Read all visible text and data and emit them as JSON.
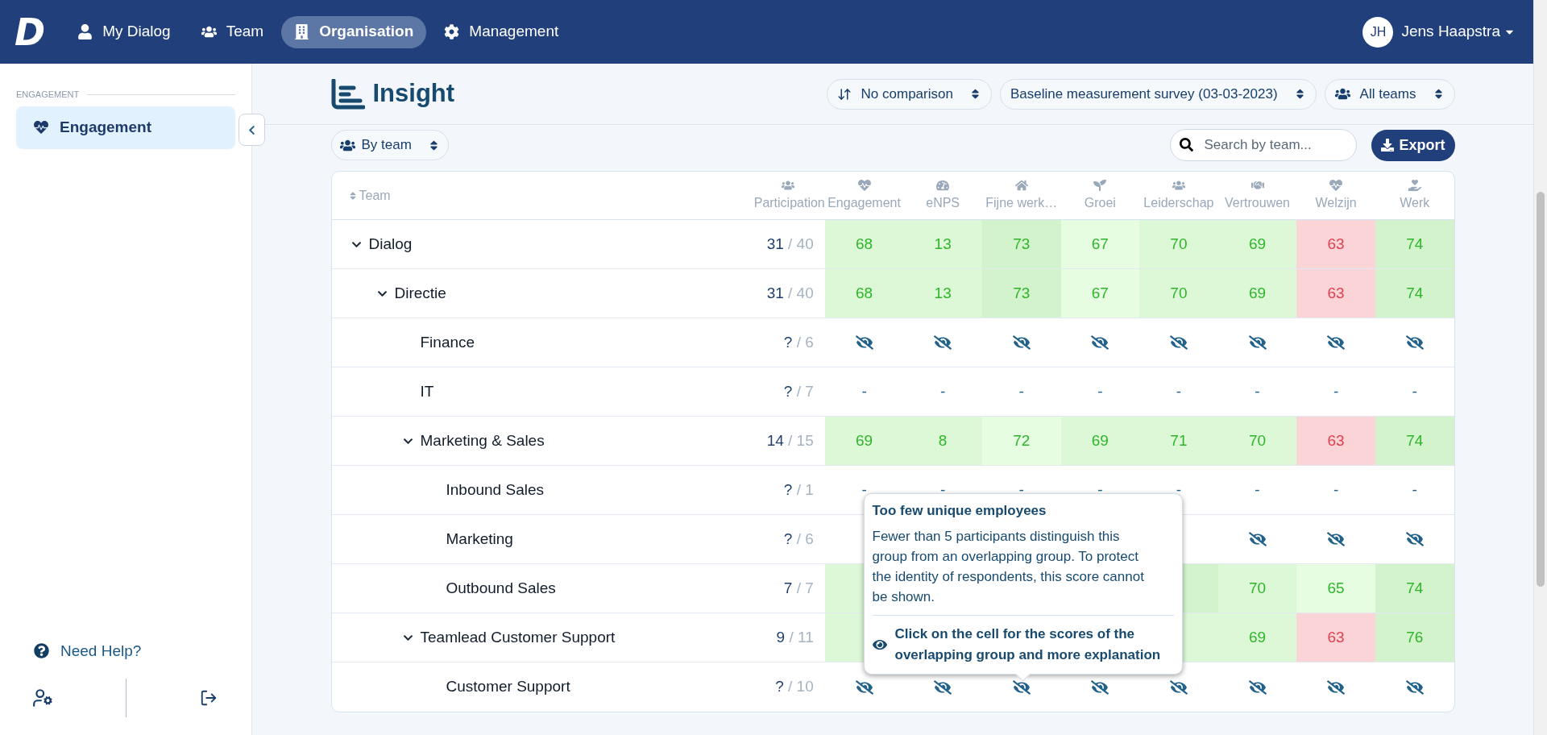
{
  "nav": {
    "logo": "D",
    "items": [
      {
        "label": "My Dialog",
        "selected": false
      },
      {
        "label": "Team",
        "selected": false
      },
      {
        "label": "Organisation",
        "selected": true
      },
      {
        "label": "Management",
        "selected": false
      }
    ],
    "user": {
      "initials": "JH",
      "name": "Jens Haapstra"
    }
  },
  "sidebar": {
    "section": "ENGAGEMENT",
    "items": [
      {
        "label": "Engagement",
        "selected": true
      }
    ],
    "help": "Need Help?"
  },
  "header": {
    "title": "Insight",
    "selects": [
      {
        "label": "No comparison"
      },
      {
        "label": "Baseline measurement survey (03-03-2023)"
      },
      {
        "label": "All teams"
      }
    ]
  },
  "toolbar": {
    "group_by": "By team",
    "search": {
      "placeholder": "Search by team..."
    },
    "export": "Export"
  },
  "table": {
    "team_column": "Team",
    "participation_column": "Participation",
    "columns": [
      "Engagement",
      "eNPS",
      "Fijne werk…",
      "Groei",
      "Leiderschap",
      "Vertrouwen",
      "Welzijn",
      "Werk"
    ],
    "rows": [
      {
        "name": "Dialog",
        "expanded": true,
        "count": "31",
        "of": "/ 40",
        "cells": [
          {
            "kind": "score",
            "value": "68",
            "color": "#dcf8d7",
            "alert": false
          },
          {
            "kind": "score",
            "value": "13",
            "color": "#dcf8d7",
            "alert": false
          },
          {
            "kind": "score",
            "value": "73",
            "color": "#d3f3cd",
            "alert": false
          },
          {
            "kind": "score",
            "value": "67",
            "color": "#e6fde2",
            "alert": false
          },
          {
            "kind": "score",
            "value": "70",
            "color": "#dcf8d7",
            "alert": false
          },
          {
            "kind": "score",
            "value": "69",
            "color": "#dcf8d7",
            "alert": false
          },
          {
            "kind": "score",
            "value": "63",
            "color": "#fbd4d8",
            "alert": true
          },
          {
            "kind": "score",
            "value": "74",
            "color": "#d3f3cd",
            "alert": false
          }
        ],
        "children": [
          {
            "name": "Directie",
            "expanded": true,
            "count": "31",
            "of": "/ 40",
            "cells": [
              {
                "kind": "score",
                "value": "68",
                "color": "#dcf8d7",
                "alert": false
              },
              {
                "kind": "score",
                "value": "13",
                "color": "#dcf8d7",
                "alert": false
              },
              {
                "kind": "score",
                "value": "73",
                "color": "#d3f3cd",
                "alert": false
              },
              {
                "kind": "score",
                "value": "67",
                "color": "#e6fde2",
                "alert": false
              },
              {
                "kind": "score",
                "value": "70",
                "color": "#dcf8d7",
                "alert": false
              },
              {
                "kind": "score",
                "value": "69",
                "color": "#dcf8d7",
                "alert": false
              },
              {
                "kind": "score",
                "value": "63",
                "color": "#fbd4d8",
                "alert": true
              },
              {
                "kind": "score",
                "value": "74",
                "color": "#d3f3cd",
                "alert": false
              }
            ],
            "children": [
              {
                "name": "Finance",
                "count": "?",
                "of": "/ 6",
                "cells": [
                  {
                    "kind": "hidden"
                  },
                  {
                    "kind": "hidden"
                  },
                  {
                    "kind": "hidden"
                  },
                  {
                    "kind": "hidden"
                  },
                  {
                    "kind": "hidden"
                  },
                  {
                    "kind": "hidden"
                  },
                  {
                    "kind": "hidden"
                  },
                  {
                    "kind": "hidden"
                  }
                ]
              },
              {
                "name": "IT",
                "count": "?",
                "of": "/ 7",
                "cells": [
                  {
                    "kind": "none",
                    "value": "-"
                  },
                  {
                    "kind": "none",
                    "value": "-"
                  },
                  {
                    "kind": "none",
                    "value": "-"
                  },
                  {
                    "kind": "none",
                    "value": "-"
                  },
                  {
                    "kind": "none",
                    "value": "-"
                  },
                  {
                    "kind": "none",
                    "value": "-"
                  },
                  {
                    "kind": "none",
                    "value": "-"
                  },
                  {
                    "kind": "none",
                    "value": "-"
                  }
                ]
              },
              {
                "name": "Marketing & Sales",
                "expanded": true,
                "count": "14",
                "of": "/ 15",
                "cells": [
                  {
                    "kind": "score",
                    "value": "69",
                    "color": "#dcf8d7",
                    "alert": false
                  },
                  {
                    "kind": "score",
                    "value": "8",
                    "color": "#dcf8d7",
                    "alert": false
                  },
                  {
                    "kind": "score",
                    "value": "72",
                    "color": "#e6fde2",
                    "alert": false
                  },
                  {
                    "kind": "score",
                    "value": "69",
                    "color": "#dcf8d7",
                    "alert": false
                  },
                  {
                    "kind": "score",
                    "value": "71",
                    "color": "#dcf8d7",
                    "alert": false
                  },
                  {
                    "kind": "score",
                    "value": "70",
                    "color": "#dcf8d7",
                    "alert": false
                  },
                  {
                    "kind": "score",
                    "value": "63",
                    "color": "#fbd4d8",
                    "alert": true
                  },
                  {
                    "kind": "score",
                    "value": "74",
                    "color": "#d3f3cd",
                    "alert": false
                  }
                ],
                "children": [
                  {
                    "name": "Inbound Sales",
                    "count": "?",
                    "of": "/ 1",
                    "cells": [
                      {
                        "kind": "none",
                        "value": "-"
                      },
                      {
                        "kind": "none",
                        "value": "-"
                      },
                      {
                        "kind": "none",
                        "value": "-"
                      },
                      {
                        "kind": "none",
                        "value": "-"
                      },
                      {
                        "kind": "none",
                        "value": "-"
                      },
                      {
                        "kind": "none",
                        "value": "-"
                      },
                      {
                        "kind": "none",
                        "value": "-"
                      },
                      {
                        "kind": "none",
                        "value": "-"
                      }
                    ]
                  },
                  {
                    "name": "Marketing",
                    "count": "?",
                    "of": "/ 6",
                    "cells": [
                      {
                        "kind": "covered"
                      },
                      {
                        "kind": "covered"
                      },
                      {
                        "kind": "covered"
                      },
                      {
                        "kind": "covered"
                      },
                      {
                        "kind": "covered"
                      },
                      {
                        "kind": "hidden"
                      },
                      {
                        "kind": "hidden"
                      },
                      {
                        "kind": "hidden"
                      }
                    ]
                  },
                  {
                    "name": "Outbound Sales",
                    "count": "7",
                    "of": "/ 7",
                    "cells": [
                      {
                        "kind": "covered",
                        "color": "#dcf8d7"
                      },
                      {
                        "kind": "covered"
                      },
                      {
                        "kind": "covered"
                      },
                      {
                        "kind": "covered"
                      },
                      {
                        "kind": "covered",
                        "color": "#d3f3cd"
                      },
                      {
                        "kind": "score",
                        "value": "70",
                        "color": "#dcf8d7",
                        "alert": false
                      },
                      {
                        "kind": "score",
                        "value": "65",
                        "color": "#e6fde2",
                        "alert": false
                      },
                      {
                        "kind": "score",
                        "value": "74",
                        "color": "#d3f3cd",
                        "alert": false
                      }
                    ]
                  }
                ]
              },
              {
                "name": "Teamlead Customer Support",
                "expanded": true,
                "count": "9",
                "of": "/ 11",
                "cells": [
                  {
                    "kind": "covered",
                    "color": "#dcf8d7"
                  },
                  {
                    "kind": "covered"
                  },
                  {
                    "kind": "covered"
                  },
                  {
                    "kind": "covered"
                  },
                  {
                    "kind": "covered",
                    "color": "#dcf8d7"
                  },
                  {
                    "kind": "score",
                    "value": "69",
                    "color": "#dcf8d7",
                    "alert": false
                  },
                  {
                    "kind": "score",
                    "value": "63",
                    "color": "#fbd4d8",
                    "alert": true
                  },
                  {
                    "kind": "score",
                    "value": "76",
                    "color": "#d3f3cd",
                    "alert": false
                  }
                ],
                "children": [
                  {
                    "name": "Customer Support",
                    "count": "?",
                    "of": "/ 10",
                    "cells": [
                      {
                        "kind": "hidden"
                      },
                      {
                        "kind": "hidden"
                      },
                      {
                        "kind": "hidden"
                      },
                      {
                        "kind": "hidden"
                      },
                      {
                        "kind": "hidden"
                      },
                      {
                        "kind": "hidden"
                      },
                      {
                        "kind": "hidden"
                      },
                      {
                        "kind": "hidden"
                      }
                    ]
                  }
                ]
              }
            ]
          }
        ]
      }
    ],
    "tooltip": {
      "title": "Too few unique employees",
      "body": "Fewer than 5 participants distinguish this group from an overlapping group. To protect the identity of respondents, this score cannot be shown.",
      "action": "Click on the cell for the scores of the overlapping group and more explanation"
    }
  }
}
